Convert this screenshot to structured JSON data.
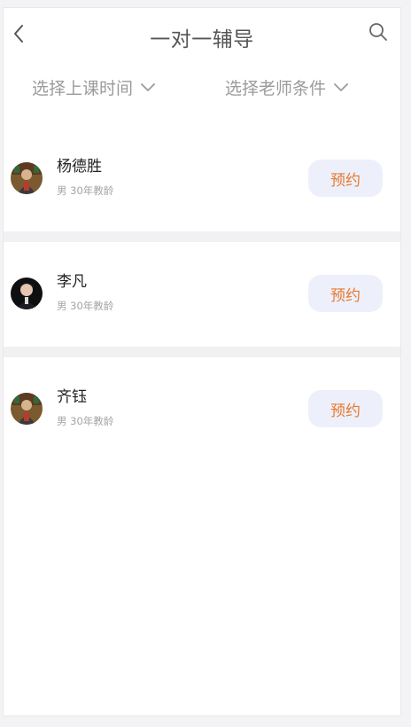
{
  "header": {
    "title": "一对一辅导",
    "back_icon": "chevron-left-icon",
    "search_icon": "search-icon"
  },
  "filters": [
    {
      "label": "选择上课时间",
      "icon": "chevron-down-icon"
    },
    {
      "label": "选择老师条件",
      "icon": "chevron-down-icon"
    }
  ],
  "teachers": [
    {
      "name": "杨德胜",
      "meta": "男 30年教龄",
      "action": "预约"
    },
    {
      "name": "李凡",
      "meta": "男 30年教龄",
      "action": "预约"
    },
    {
      "name": "齐钰",
      "meta": "男 30年教龄",
      "action": "预约"
    }
  ],
  "colors": {
    "accent_text": "#e9782d",
    "button_bg": "#edf0fb",
    "divider": "#f1f1f4"
  }
}
